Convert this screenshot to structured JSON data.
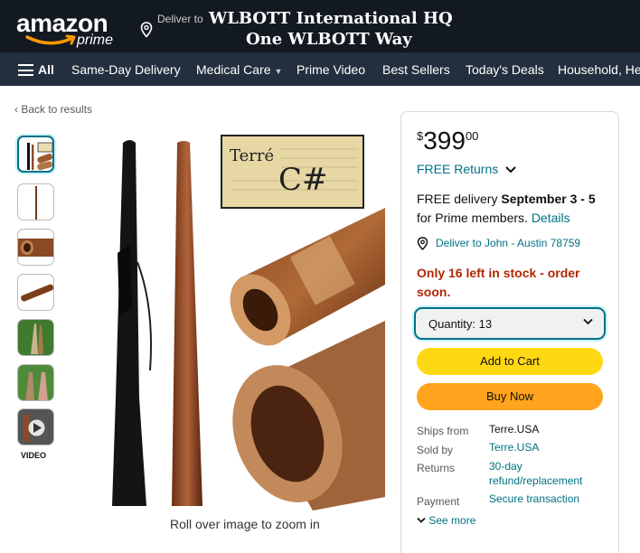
{
  "header": {
    "logo_text": "amazon",
    "logo_sub": "prime",
    "deliver_label": "Deliver to",
    "deliver_line1": "WLBOTT International HQ",
    "deliver_line2": "One WLBOTT Way"
  },
  "nav": {
    "all": "All",
    "items": [
      "Same-Day Delivery",
      "Medical Care",
      "Prime Video",
      "Best Sellers",
      "Today's Deals",
      "Household, He"
    ]
  },
  "breadcrumb": {
    "back": "‹  Back to results"
  },
  "gallery": {
    "video_label": "VIDEO",
    "zoom_hint": "Roll over image to zoom in",
    "brand_card_text": "Terré",
    "brand_card_note": "C#"
  },
  "buybox": {
    "price_symbol": "$",
    "price_whole": "399",
    "price_fraction": "00",
    "free_returns": "FREE Returns",
    "delivery_prefix": "FREE delivery ",
    "delivery_dates": "September 3 - 5",
    "delivery_suffix": "for Prime members. ",
    "delivery_link": "Details",
    "deliver_to": "Deliver to John - Austin 78759",
    "stock": "Only 16 left in stock - order soon.",
    "quantity_label": "Quantity:",
    "quantity_value": "13",
    "add_to_cart": "Add to Cart",
    "buy_now": "Buy Now",
    "ships_from_label": "Ships from",
    "ships_from_value": "Terre.USA",
    "sold_by_label": "Sold by",
    "sold_by_value": "Terre.USA",
    "returns_label": "Returns",
    "returns_value": "30-day refund/replacement",
    "payment_label": "Payment",
    "payment_value": "Secure transaction",
    "see_more": "See more"
  },
  "colors": {
    "header_bg": "#131921",
    "nav_bg": "#232f3e",
    "link": "#007185",
    "stock": "#b12704",
    "cart_button": "#ffd814",
    "buy_button": "#ffa41c"
  }
}
